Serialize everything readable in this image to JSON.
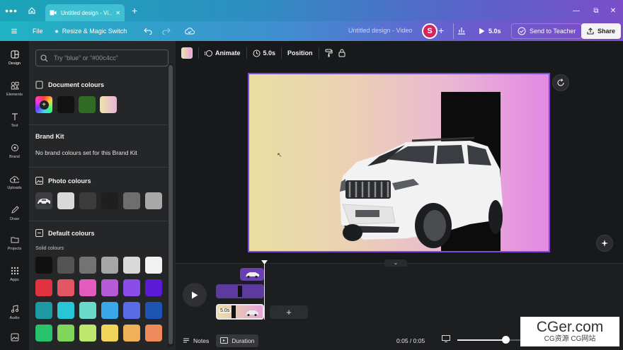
{
  "browser": {
    "menu_glyph": "•••",
    "tab_title": "Untitled design - Vi...",
    "tab_close": "✕",
    "new_tab": "+",
    "window_controls": {
      "minimize": "—",
      "restore": "⧉",
      "close": "✕"
    }
  },
  "toolbar": {
    "menu_glyph": "≡",
    "file": "File",
    "resize_label": "Resize & Magic Switch",
    "doc_title": "Untitled design - Video",
    "avatar_initial": "S",
    "add_glyph": "+",
    "duration": "5.0s",
    "send_to_teacher": "Send to Teacher",
    "share": "Share"
  },
  "rail": [
    {
      "label": "Design",
      "icon": "design-icon"
    },
    {
      "label": "Elements",
      "icon": "elements-icon"
    },
    {
      "label": "Text",
      "icon": "text-icon"
    },
    {
      "label": "Brand",
      "icon": "brand-icon"
    },
    {
      "label": "Uploads",
      "icon": "uploads-icon"
    },
    {
      "label": "Draw",
      "icon": "draw-icon"
    },
    {
      "label": "Projects",
      "icon": "projects-icon"
    },
    {
      "label": "Apps",
      "icon": "apps-icon"
    },
    {
      "label": "Audio",
      "icon": "audio-icon"
    }
  ],
  "panel": {
    "search_placeholder": "Try “blue” or “#00c4cc”",
    "document_colours": {
      "title": "Document colours",
      "swatches": [
        "#121212",
        "#2f6b22",
        "linear-gradient(90deg,#efe3a8,#e6b3d8)"
      ]
    },
    "brand_kit": {
      "title": "Brand Kit",
      "message": "No brand colours set for this Brand Kit"
    },
    "photo_colours": {
      "title": "Photo colours",
      "swatches": [
        "#d9d9d9",
        "#3c3c3c",
        "#1f1f1f",
        "#6e6e6e",
        "#a9a9a9"
      ]
    },
    "default_colours": {
      "title": "Default colours",
      "subtitle": "Solid colours",
      "rows": [
        [
          "#111111",
          "#545454",
          "#737373",
          "#a6a6a6",
          "#d9d9d9",
          "#f2f2f2"
        ],
        [
          "#e0323f",
          "#e35664",
          "#e35bbd",
          "#b55bd6",
          "#8a4de8",
          "#5b1ad6"
        ],
        [
          "#1e9aa4",
          "#27c5d6",
          "#6bdacc",
          "#3aa8e6",
          "#5a6be6",
          "#1d55b5"
        ],
        [
          "#27c26b",
          "#7fd65a",
          "#bde86e",
          "#f0d35b",
          "#f0b05a",
          "#ee8a5b"
        ]
      ]
    }
  },
  "context_toolbar": {
    "animate": "Animate",
    "duration": "5.0s",
    "position": "Position"
  },
  "timeline": {
    "clip_duration": "5.0s",
    "add_glyph": "+"
  },
  "bottom": {
    "notes": "Notes",
    "duration": "Duration",
    "time": "0:05 / 0:05",
    "timeline_position": 0.75
  },
  "watermark": {
    "main": "CGer.com",
    "sub": "CG资源 CG网站"
  }
}
